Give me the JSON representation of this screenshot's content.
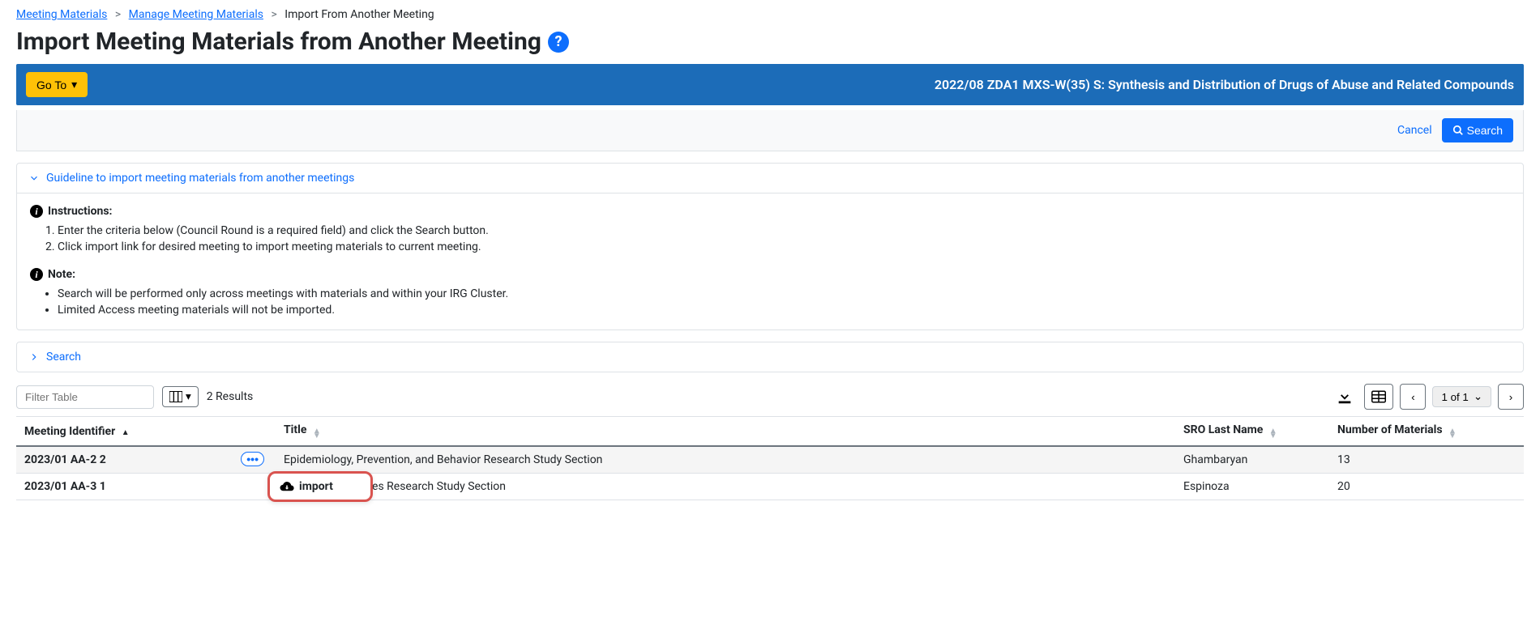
{
  "breadcrumb": {
    "items": [
      {
        "label": "Meeting Materials",
        "link": true
      },
      {
        "label": "Manage Meeting Materials",
        "link": true
      },
      {
        "label": "Import From Another Meeting",
        "link": false
      }
    ]
  },
  "page_title": "Import Meeting Materials from Another Meeting",
  "banner": {
    "goto_label": "Go To",
    "meeting_title": "2022/08 ZDA1 MXS-W(35) S: Synthesis and Distribution of Drugs of Abuse and Related Compounds"
  },
  "actions": {
    "cancel": "Cancel",
    "search": "Search"
  },
  "guideline_panel": {
    "title": "Guideline to import meeting materials from another meetings",
    "instructions_heading": "Instructions:",
    "instructions": [
      "Enter the criteria below (Council Round is a required field) and click the Search button.",
      "Click import link for desired meeting to import meeting materials to current meeting."
    ],
    "note_heading": "Note:",
    "notes": [
      "Search will be performed only across meetings with materials and within your IRG Cluster.",
      "Limited Access meeting materials will not be imported."
    ]
  },
  "search_panel": {
    "title": "Search"
  },
  "toolbar": {
    "filter_placeholder": "Filter Table",
    "results_text": "2 Results",
    "page_text": "1 of 1"
  },
  "columns": {
    "id": "Meeting Identifier",
    "title": "Title",
    "sro": "SRO Last Name",
    "num": "Number of Materials"
  },
  "rows": [
    {
      "id": "2023/01 AA-2 2",
      "title": "Epidemiology, Prevention, and Behavior Research Study Section",
      "sro": "Ghambaryan",
      "num": "13"
    },
    {
      "id": "2023/01 AA-3 1",
      "title": "and Health Services Research Study Section",
      "sro": "Espinoza",
      "num": "20"
    }
  ],
  "popup": {
    "label": "import"
  }
}
